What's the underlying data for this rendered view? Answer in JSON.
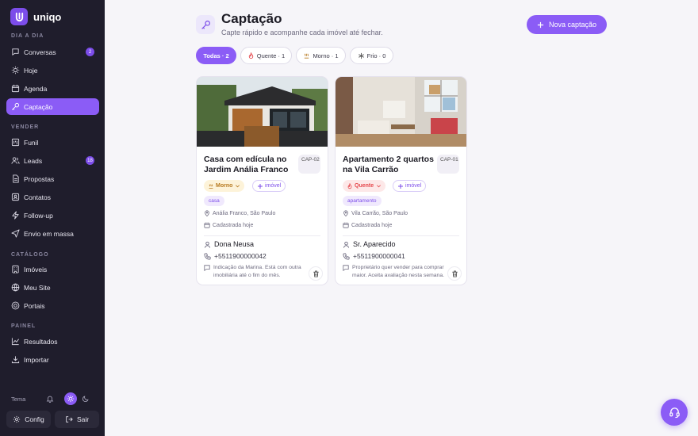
{
  "app": {
    "name": "uniqo",
    "logo_letter": "U"
  },
  "sidebar": {
    "sections": [
      {
        "label": "DIA A DIA",
        "items": [
          {
            "label": "Conversas",
            "icon": "chat-icon",
            "badge": "2"
          },
          {
            "label": "Hoje",
            "icon": "sun-icon"
          },
          {
            "label": "Agenda",
            "icon": "calendar-icon"
          },
          {
            "label": "Captação",
            "icon": "key-icon",
            "active": true
          }
        ]
      },
      {
        "label": "VENDER",
        "items": [
          {
            "label": "Funil",
            "icon": "kanban-icon"
          },
          {
            "label": "Leads",
            "icon": "users-icon",
            "badge": "18"
          },
          {
            "label": "Propostas",
            "icon": "document-icon"
          },
          {
            "label": "Contatos",
            "icon": "contacts-icon"
          },
          {
            "label": "Follow-up",
            "icon": "zap-icon"
          },
          {
            "label": "Envio em massa",
            "icon": "send-icon"
          }
        ]
      },
      {
        "label": "CATÁLOGO",
        "items": [
          {
            "label": "Imóveis",
            "icon": "building-icon"
          },
          {
            "label": "Meu Site",
            "icon": "globe-icon"
          },
          {
            "label": "Portais",
            "icon": "portal-icon"
          }
        ]
      },
      {
        "label": "PAINEL",
        "items": [
          {
            "label": "Resultados",
            "icon": "chart-icon"
          },
          {
            "label": "Importar",
            "icon": "download-icon"
          }
        ]
      }
    ],
    "tema_label": "Tema",
    "config_label": "Config",
    "sair_label": "Sair"
  },
  "page": {
    "title": "Captação",
    "subtitle": "Capte rápido e acompanhe cada imóvel até fechar.",
    "new_button": "Nova captação"
  },
  "filters": [
    {
      "label": "Todas · 2",
      "selected": true
    },
    {
      "label": "Quente · 1",
      "icon": "flame-icon"
    },
    {
      "label": "Morno · 1",
      "icon": "warm-icon"
    },
    {
      "label": "Frio · 0",
      "icon": "snowflake-icon"
    }
  ],
  "cards": [
    {
      "title": "Casa com edícula no Jardim Anália Franco",
      "code": "CAP-02",
      "temperature": "Morno",
      "type_label": "imóvel",
      "tag": "casa",
      "location": "Anália Franco, São Paulo",
      "registered": "Cadastrada hoje",
      "owner": "Dona Neusa",
      "phone": "+5511900000042",
      "note": "Indicação da Marina. Está com outra imobiliária até o fim do mês."
    },
    {
      "title": "Apartamento 2 quartos na Vila Carrão",
      "code": "CAP-01",
      "temperature": "Quente",
      "type_label": "imóvel",
      "tag": "apartamento",
      "location": "Vila Carrão, São Paulo",
      "registered": "Cadastrada hoje",
      "owner": "Sr. Aparecido",
      "phone": "+5511900000041",
      "note": "Proprietário quer vender para comprar maior. Aceita avaliação nesta semana."
    }
  ],
  "colors": {
    "accent": "#8b5cf6",
    "sidebar": "#1f1d2c",
    "morno": "#b7791f",
    "quente": "#e5484d"
  }
}
